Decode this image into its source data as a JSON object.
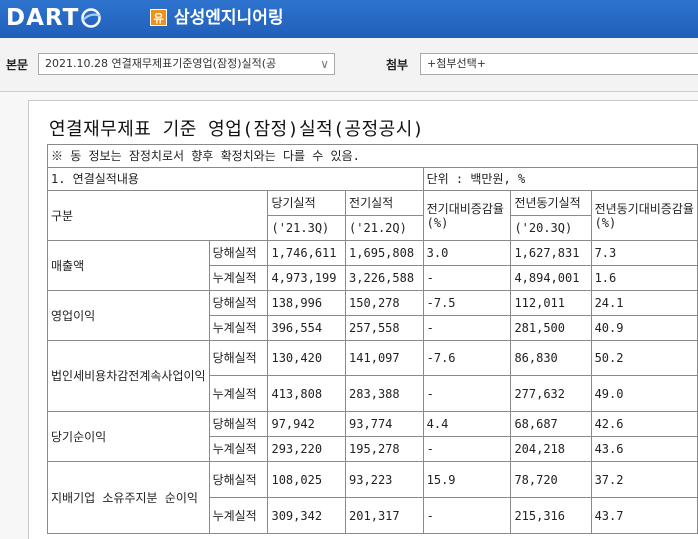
{
  "header": {
    "logo_text": "DART",
    "badge": "유",
    "company_name": "삼성엔지니어링"
  },
  "toolbar": {
    "main_label": "본문",
    "main_select_value": "2021.10.28  연결재무제표기준영업(잠정)실적(공",
    "attach_label": "첨부",
    "attach_select_value": "+첨부선택+"
  },
  "document": {
    "title": "연결재무제표 기준 영업(잠정)실적(공정공시)",
    "notice": "※ 동 정보는 잠정치로서 향후 확정치와는 다를 수 있음.",
    "section": "1. 연결실적내용",
    "unit": "단위 : 백만원, %",
    "headers": {
      "category": "구분",
      "current": "당기실적",
      "current_period": "('21.3Q)",
      "previous": "전기실적",
      "previous_period": "('21.2Q)",
      "qoq": "전기대비증감율(%)",
      "yoy_actual": "전년동기실적",
      "yoy_period": "('20.3Q)",
      "yoy": "전년동기대비증감율(%)"
    },
    "rows": [
      {
        "item": "매출액",
        "quarter": {
          "label": "당해실적",
          "cur": "1,746,611",
          "prev": "1,695,808",
          "qoq": "3.0",
          "yoy_val": "1,627,831",
          "yoy": "7.3"
        },
        "cumul": {
          "label": "누계실적",
          "cur": "4,973,199",
          "prev": "3,226,588",
          "qoq": "-",
          "yoy_val": "4,894,001",
          "yoy": "1.6"
        }
      },
      {
        "item": "영업이익",
        "quarter": {
          "label": "당해실적",
          "cur": "138,996",
          "prev": "150,278",
          "qoq": "-7.5",
          "yoy_val": "112,011",
          "yoy": "24.1"
        },
        "cumul": {
          "label": "누계실적",
          "cur": "396,554",
          "prev": "257,558",
          "qoq": "-",
          "yoy_val": "281,500",
          "yoy": "40.9"
        }
      },
      {
        "item": "법인세비용차감전계속사업이익",
        "quarter": {
          "label": "당해실적",
          "cur": "130,420",
          "prev": "141,097",
          "qoq": "-7.6",
          "yoy_val": "86,830",
          "yoy": "50.2"
        },
        "cumul": {
          "label": "누계실적",
          "cur": "413,808",
          "prev": "283,388",
          "qoq": "-",
          "yoy_val": "277,632",
          "yoy": "49.0"
        }
      },
      {
        "item": "당기순이익",
        "quarter": {
          "label": "당해실적",
          "cur": "97,942",
          "prev": "93,774",
          "qoq": "4.4",
          "yoy_val": "68,687",
          "yoy": "42.6"
        },
        "cumul": {
          "label": "누계실적",
          "cur": "293,220",
          "prev": "195,278",
          "qoq": "-",
          "yoy_val": "204,218",
          "yoy": "43.6"
        }
      },
      {
        "item": "지배기업 소유주지분 순이익",
        "quarter": {
          "label": "당해실적",
          "cur": "108,025",
          "prev": "93,223",
          "qoq": "15.9",
          "yoy_val": "78,720",
          "yoy": "37.2"
        },
        "cumul": {
          "label": "누계실적",
          "cur": "309,342",
          "prev": "201,317",
          "qoq": "-",
          "yoy_val": "215,316",
          "yoy": "43.7"
        }
      }
    ]
  }
}
